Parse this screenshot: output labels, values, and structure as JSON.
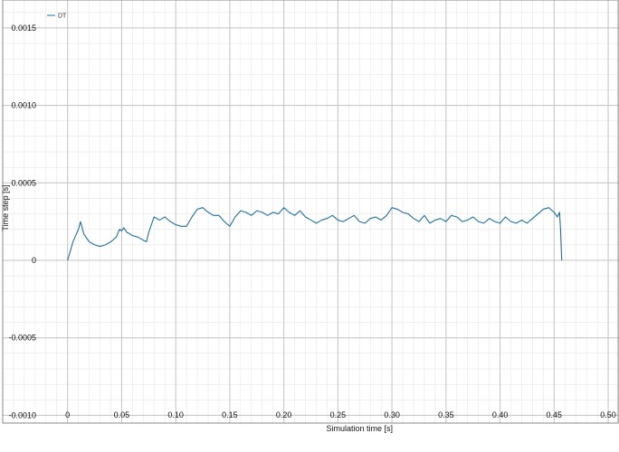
{
  "chart_data": {
    "type": "line",
    "xlabel": "Simulation time [s]",
    "ylabel": "Time step [s]",
    "xlim": [
      -0.06,
      0.51
    ],
    "ylim": [
      -0.00105,
      0.00168
    ],
    "x_ticks": [
      0,
      0.05,
      0.1,
      0.15,
      0.2,
      0.25,
      0.3,
      0.35,
      0.4,
      0.45,
      0.5
    ],
    "x_tick_labels": [
      "0",
      "0.05",
      "0.10",
      "0.15",
      "0.20",
      "0.25",
      "0.30",
      "0.35",
      "0.40",
      "0.45",
      "0.50"
    ],
    "y_ticks": [
      -0.001,
      -0.0005,
      0,
      0.0005,
      0.001,
      0.0015
    ],
    "y_tick_labels": [
      "-0.0010",
      "-0.0005",
      "0",
      "0.0005",
      "0.0010",
      "0.0015"
    ],
    "grid": true,
    "minor_grid": true,
    "legend": "top-left",
    "line_color": "#1f6fa3",
    "series": [
      {
        "name": "DT",
        "x": [
          0,
          0.005,
          0.01,
          0.012,
          0.015,
          0.02,
          0.025,
          0.03,
          0.035,
          0.04,
          0.045,
          0.048,
          0.05,
          0.052,
          0.055,
          0.06,
          0.065,
          0.07,
          0.073,
          0.075,
          0.08,
          0.085,
          0.09,
          0.095,
          0.1,
          0.105,
          0.11,
          0.115,
          0.12,
          0.125,
          0.13,
          0.135,
          0.14,
          0.145,
          0.15,
          0.155,
          0.16,
          0.165,
          0.17,
          0.175,
          0.18,
          0.185,
          0.19,
          0.195,
          0.2,
          0.205,
          0.21,
          0.215,
          0.22,
          0.225,
          0.23,
          0.235,
          0.24,
          0.245,
          0.25,
          0.255,
          0.26,
          0.265,
          0.27,
          0.275,
          0.28,
          0.285,
          0.29,
          0.295,
          0.3,
          0.305,
          0.31,
          0.315,
          0.32,
          0.325,
          0.33,
          0.335,
          0.34,
          0.345,
          0.35,
          0.355,
          0.36,
          0.365,
          0.37,
          0.375,
          0.38,
          0.385,
          0.39,
          0.395,
          0.4,
          0.405,
          0.41,
          0.415,
          0.42,
          0.425,
          0.43,
          0.435,
          0.44,
          0.445,
          0.45,
          0.453,
          0.455,
          0.456,
          0.457
        ],
        "y": [
          0,
          0.00012,
          0.0002,
          0.00025,
          0.00017,
          0.00012,
          0.0001,
          9e-05,
          0.0001,
          0.00012,
          0.00015,
          0.0002,
          0.00019,
          0.00021,
          0.00018,
          0.00016,
          0.00015,
          0.00013,
          0.00012,
          0.00018,
          0.00028,
          0.00026,
          0.00028,
          0.00025,
          0.00023,
          0.00022,
          0.00022,
          0.00028,
          0.00033,
          0.00034,
          0.00031,
          0.00029,
          0.00029,
          0.00025,
          0.00022,
          0.00028,
          0.00032,
          0.00031,
          0.00029,
          0.00032,
          0.00031,
          0.00029,
          0.00031,
          0.0003,
          0.00034,
          0.00031,
          0.00029,
          0.00032,
          0.00028,
          0.00026,
          0.00024,
          0.00026,
          0.00027,
          0.00029,
          0.00026,
          0.00025,
          0.00027,
          0.00029,
          0.00025,
          0.00024,
          0.00027,
          0.00028,
          0.00026,
          0.00029,
          0.00034,
          0.00033,
          0.00031,
          0.0003,
          0.00027,
          0.00025,
          0.00029,
          0.00024,
          0.00026,
          0.00027,
          0.00025,
          0.00029,
          0.00028,
          0.00025,
          0.00026,
          0.00028,
          0.00025,
          0.00024,
          0.00027,
          0.00025,
          0.00024,
          0.00028,
          0.00025,
          0.00024,
          0.00026,
          0.00024,
          0.00027,
          0.0003,
          0.00033,
          0.00034,
          0.00031,
          0.00028,
          0.00031,
          0.00019,
          0
        ]
      }
    ]
  }
}
